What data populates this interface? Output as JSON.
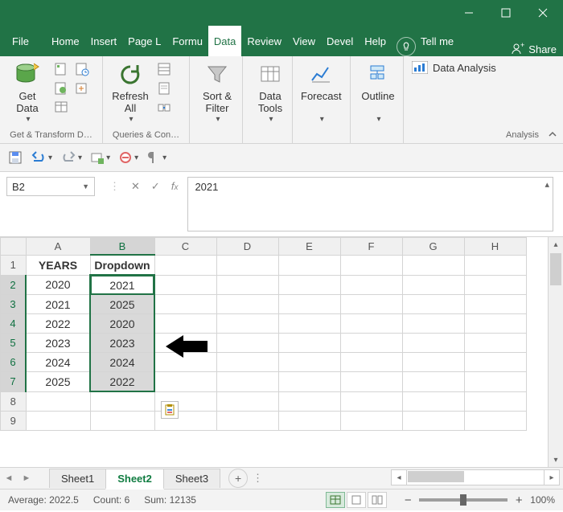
{
  "titlebar": {
    "minimize": "minimize",
    "maximize": "maximize",
    "close": "close"
  },
  "tabs": {
    "file": "File",
    "items": [
      "Home",
      "Insert",
      "Page L",
      "Formu",
      "Data",
      "Review",
      "View",
      "Devel",
      "Help"
    ],
    "active_index": 4,
    "tellme": "Tell me",
    "share": "Share"
  },
  "ribbon": {
    "group1": {
      "title": "Get & Transform D…",
      "get_data": "Get\nData"
    },
    "group2": {
      "title": "Queries & Con…",
      "refresh_all": "Refresh\nAll"
    },
    "group3": {
      "sort_filter": "Sort &\nFilter"
    },
    "group4": {
      "data_tools": "Data\nTools"
    },
    "group5": {
      "forecast": "Forecast"
    },
    "group6": {
      "outline": "Outline"
    },
    "analysis": {
      "button": "Data Analysis",
      "title": "Analysis"
    }
  },
  "qat": {
    "save": "save",
    "undo": "undo",
    "redo": "redo"
  },
  "formula_bar": {
    "name_box": "B2",
    "value": "2021"
  },
  "grid": {
    "columns": [
      "A",
      "B",
      "C",
      "D",
      "E",
      "F",
      "G",
      "H"
    ],
    "rows": [
      "1",
      "2",
      "3",
      "4",
      "5",
      "6",
      "7",
      "8",
      "9"
    ],
    "selected_col": "B",
    "selected_rows": [
      "2",
      "3",
      "4",
      "5",
      "6",
      "7"
    ],
    "headers": {
      "A1": "YEARS",
      "B1": "Dropdown"
    },
    "colA": [
      "2020",
      "2021",
      "2022",
      "2023",
      "2024",
      "2025"
    ],
    "colB": [
      "2021",
      "2025",
      "2020",
      "2023",
      "2024",
      "2022"
    ]
  },
  "sheet_tabs": {
    "items": [
      "Sheet1",
      "Sheet2",
      "Sheet3"
    ],
    "active_index": 1
  },
  "status": {
    "average_label": "Average:",
    "average": "2022.5",
    "count_label": "Count:",
    "count": "6",
    "sum_label": "Sum:",
    "sum": "12135",
    "zoom": "100%"
  },
  "chart_data": {
    "type": "table",
    "headers": [
      "YEARS",
      "Dropdown"
    ],
    "rows": [
      [
        2020,
        2021
      ],
      [
        2021,
        2025
      ],
      [
        2022,
        2020
      ],
      [
        2023,
        2023
      ],
      [
        2024,
        2024
      ],
      [
        2025,
        2022
      ]
    ]
  }
}
